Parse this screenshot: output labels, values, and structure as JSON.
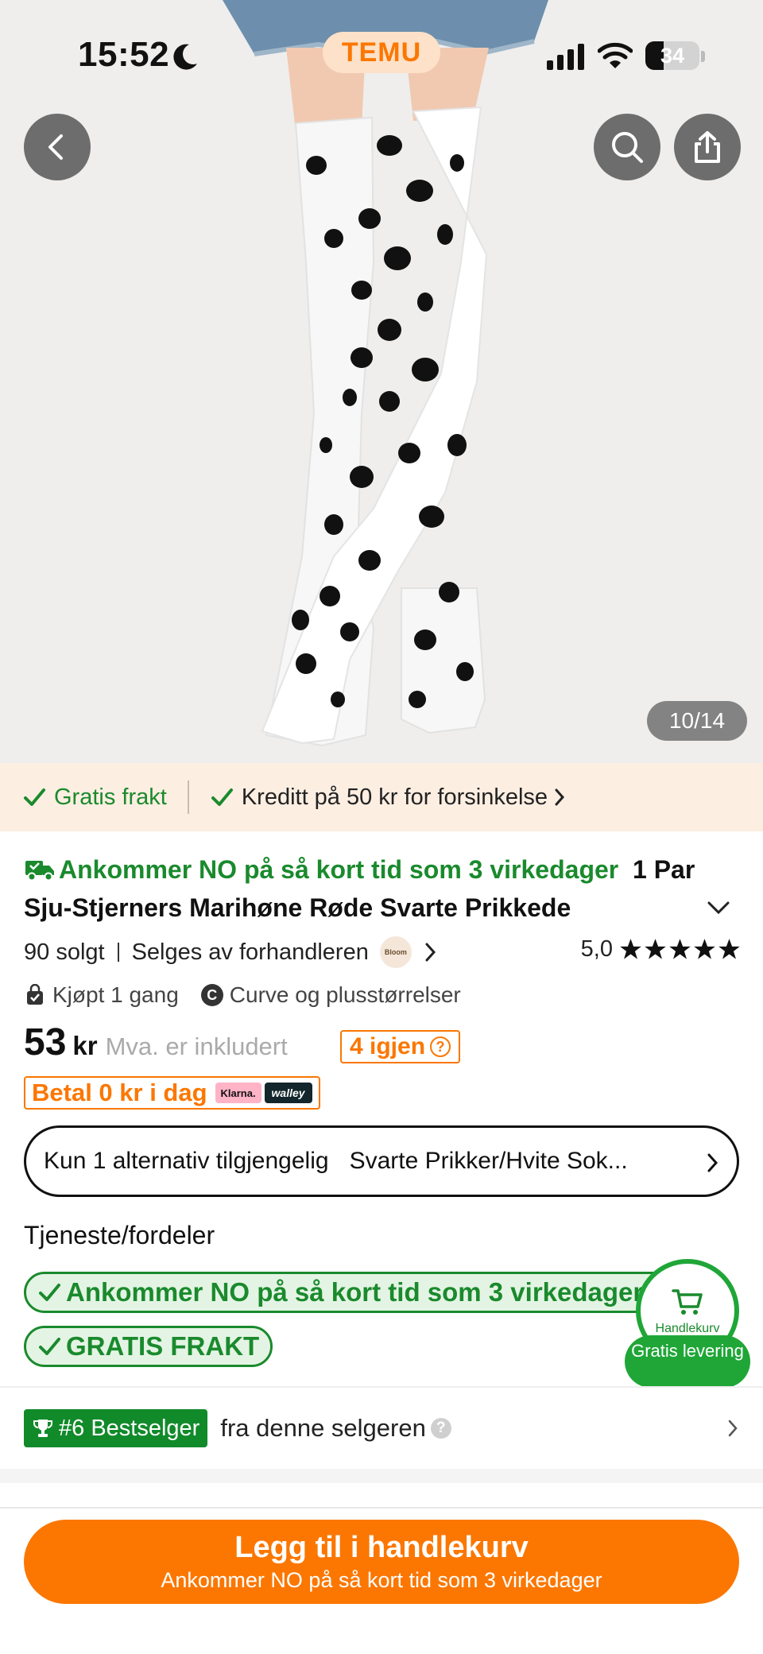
{
  "status_bar": {
    "time": "15:52",
    "brand": "TEMU",
    "battery_percent": "34"
  },
  "gallery": {
    "counter": "10/14"
  },
  "benefits": {
    "free_shipping": "Gratis frakt",
    "credit": "Kreditt på 50 kr for forsinkelse"
  },
  "product": {
    "delivery_headline": "Ankommer NO på så kort tid som 3 virkedager",
    "title": "1 Par Sju-Stjerners Marihøne Røde Svarte Prikkede",
    "sold": "90 solgt",
    "sold_by": "Selges av forhandleren",
    "seller_logo_text": "Bloom",
    "rating": "5,0",
    "stars": 5,
    "bought": "Kjøpt 1 gang",
    "curve": "Curve og plusstørrelser",
    "curve_badge": "C",
    "price": "53",
    "currency": "kr",
    "vat_note": "Mva. er inkludert",
    "stock": "4 igjen",
    "stock_help": "?",
    "paylater": "Betal 0 kr i dag",
    "klarna": "Klarna.",
    "walley": "walley"
  },
  "variant": {
    "availability": "Kun 1 alternativ tilgjengelig",
    "selected": "Svarte Prikker/Hvite Sok..."
  },
  "services": {
    "title": "Tjeneste/fordeler",
    "items": [
      "Ankommer NO på så kort tid som 3 virkedager",
      "GRATIS FRAKT"
    ]
  },
  "cart_float": {
    "label": "Handlekurv",
    "badge": "Gratis levering"
  },
  "bestseller": {
    "badge": "#6 Bestselger",
    "from": "fra denne selgeren",
    "help": "?"
  },
  "cta": {
    "label": "Legg til i handlekurv",
    "sublabel": "Ankommer NO på så kort tid som 3 virkedager"
  },
  "colors": {
    "accent": "#fb7701",
    "green": "#1a8a2d",
    "benefits_bg": "#fdeee2"
  },
  "icons": [
    "back-arrow-icon",
    "search-icon",
    "share-icon",
    "check-icon",
    "truck-icon",
    "chevron-right-icon",
    "chevron-down-icon",
    "star-icon",
    "bag-icon",
    "cart-icon",
    "trophy-icon",
    "moon-icon",
    "signal-icon",
    "wifi-icon",
    "battery-icon"
  ]
}
